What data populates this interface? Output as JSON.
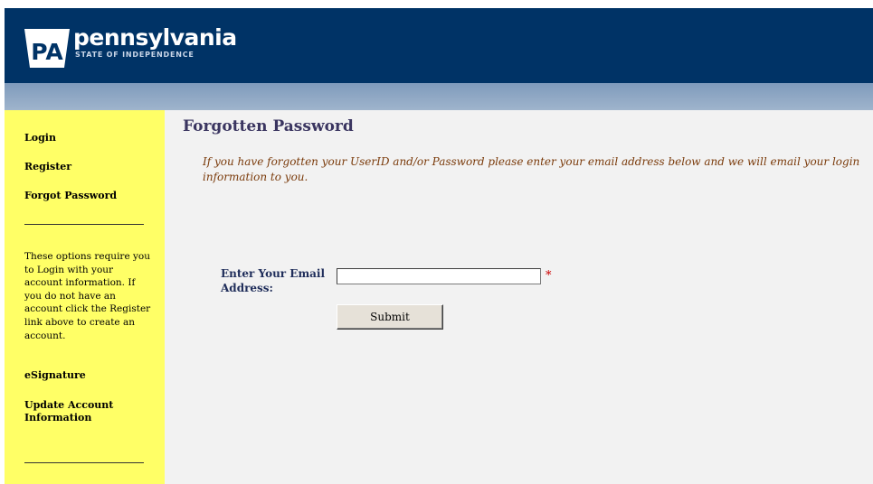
{
  "header": {
    "logo_badge": "PA",
    "brand_name": "pennsylvania",
    "tagline": "STATE OF INDEPENDENCE",
    "bg_color": "#003366"
  },
  "sidebar": {
    "bg_color": "#ffff66",
    "items": [
      {
        "label": "Login"
      },
      {
        "label": "Register"
      },
      {
        "label": "Forgot Password"
      }
    ],
    "note": "These options require you to Login with your account information.  If you do not have an account click the Register link above to create an account.",
    "secondary_items": [
      {
        "label": "eSignature"
      },
      {
        "label": "Update Account Information"
      }
    ]
  },
  "main": {
    "title": "Forgotten Password",
    "instructions": "If you have forgotten your UserID and/or Password please enter your email address below and we will email your login information to you.",
    "form": {
      "email_label": "Enter Your Email Address:",
      "email_value": "",
      "required_marker": "*",
      "submit_label": "Submit"
    }
  }
}
